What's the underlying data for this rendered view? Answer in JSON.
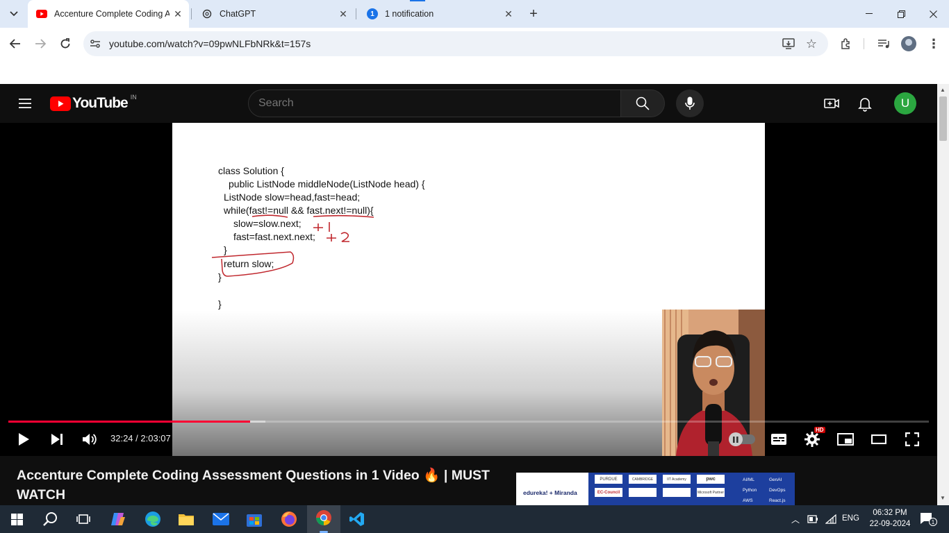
{
  "browser": {
    "tabs": [
      {
        "title": "Accenture Complete Coding As",
        "active": true
      },
      {
        "title": "ChatGPT",
        "active": false
      },
      {
        "title": "1 notification",
        "active": false
      }
    ],
    "notification_badge": "1",
    "url": "youtube.com/watch?v=09pwNLFbNRk&t=157s"
  },
  "youtube": {
    "logo_text": "YouTube",
    "region": "IN",
    "search_placeholder": "Search",
    "avatar_letter": "U",
    "accent_color": "#ff0033"
  },
  "player": {
    "code_lines": [
      "class Solution {",
      "public ListNode middleNode(ListNode head) {",
      "ListNode slow=head,fast=head;",
      "while(fast!=null && fast.next!=null){",
      "slow=slow.next;",
      "fast=fast.next.next;",
      "}",
      "return slow;",
      "}",
      "}"
    ],
    "annotations": [
      "+1",
      "+2"
    ],
    "time_current": "32:24",
    "time_separator": " / ",
    "time_total": "2:03:07",
    "progress_fraction": 0.263,
    "quality_badge": "HD"
  },
  "video": {
    "title": "Accenture Complete Coding Assessment Questions in 1 Video 🔥 | MUST WATCH"
  },
  "ad": {
    "brand": "edureka! + Miranda",
    "logos": [
      "PURDUE",
      "CAMBRIDGE",
      "IIT Academy",
      "pwc",
      "EC-Council",
      "Microsoft Partner"
    ],
    "tags": [
      "AI/ML",
      "GenAI",
      "Python",
      "DevOps",
      "AWS",
      "React.js"
    ]
  },
  "taskbar": {
    "language": "ENG",
    "time": "06:32 PM",
    "date": "22-09-2024",
    "notification_count": "1"
  }
}
